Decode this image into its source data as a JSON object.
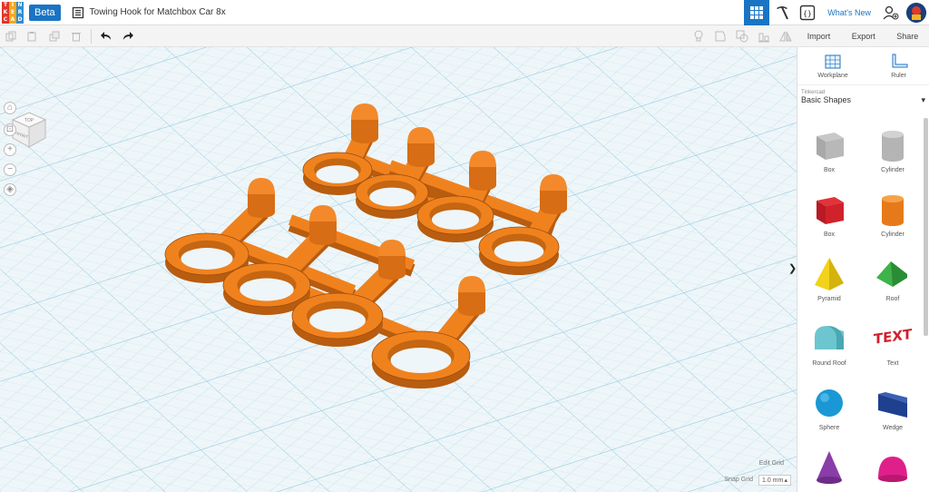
{
  "header": {
    "logo_letters": [
      "T",
      "I",
      "N",
      "K",
      "E",
      "R",
      "C",
      "A",
      "D"
    ],
    "logo_colors": [
      "#e2352b",
      "#f4a81b",
      "#2b8ed3",
      "#e2352b",
      "#f4a81b",
      "#2b8ed3",
      "#e2352b",
      "#f4a81b",
      "#2b8ed3"
    ],
    "beta_label": "Beta",
    "design_title": "Towing Hook for Matchbox Car 8x",
    "whats_new": "What's New"
  },
  "actions": {
    "import": "Import",
    "export": "Export",
    "share": "Share"
  },
  "panel": {
    "workplane": "Workplane",
    "ruler": "Ruler",
    "library_source": "Tinkercad",
    "library_name": "Basic Shapes",
    "library_caret": "▾",
    "shapes": [
      {
        "label": "Box",
        "icon": "box-hole-icon"
      },
      {
        "label": "Cylinder",
        "icon": "cylinder-hole-icon"
      },
      {
        "label": "Box",
        "icon": "box-icon"
      },
      {
        "label": "Cylinder",
        "icon": "cylinder-icon"
      },
      {
        "label": "Pyramid",
        "icon": "pyramid-icon"
      },
      {
        "label": "Roof",
        "icon": "roof-icon"
      },
      {
        "label": "Round Roof",
        "icon": "round-roof-icon"
      },
      {
        "label": "Text",
        "icon": "text-icon"
      },
      {
        "label": "Sphere",
        "icon": "sphere-icon"
      },
      {
        "label": "Wedge",
        "icon": "wedge-icon"
      },
      {
        "label": "",
        "icon": "cone-icon"
      },
      {
        "label": "",
        "icon": "half-sphere-icon"
      }
    ]
  },
  "viewport": {
    "viewcube_top": "TOP",
    "viewcube_front": "FRONT",
    "edit_grid": "Edit Grid",
    "snap_grid_label": "Snap Grid",
    "snap_grid_value": "1.0 mm",
    "snap_caret": "▴",
    "collapse_arrow": "❯"
  },
  "colors": {
    "accent": "#1a74c4",
    "object": "#f0821e",
    "grid": "#a7d3e6"
  }
}
